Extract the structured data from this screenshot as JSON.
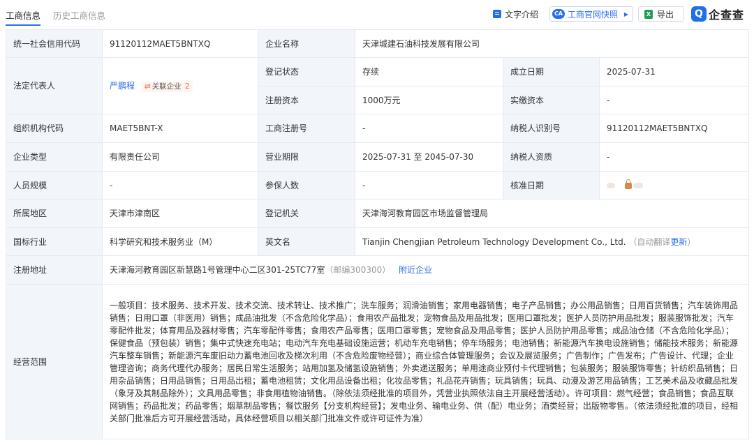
{
  "tabs": [
    {
      "label": "工商信息"
    },
    {
      "label": "历史工商信息"
    }
  ],
  "toolbar": {
    "intro_label": "文字介绍",
    "snapshot_badge": "CA",
    "snapshot_label": "工商官网快照",
    "export_label": "导出"
  },
  "logo": {
    "text": "企查查"
  },
  "labels": {
    "credit_code": "统一社会信用代码",
    "company_name": "企业名称",
    "legal_rep": "法定代表人",
    "reg_status": "登记状态",
    "est_date": "成立日期",
    "reg_capital": "注册资本",
    "paid_capital": "实缴资本",
    "org_code": "组织机构代码",
    "reg_number": "工商注册号",
    "taxpayer_id": "纳税人识别号",
    "company_type": "企业类型",
    "business_term": "营业期限",
    "taxpayer_qual": "纳税人资质",
    "staff_size": "人员规模",
    "insured": "参保人数",
    "approval_date": "核准日期",
    "region": "所属地区",
    "reg_authority": "登记机关",
    "industry": "国标行业",
    "english_name": "英文名",
    "reg_address": "注册地址",
    "business_scope": "经营范围"
  },
  "values": {
    "credit_code": "91120112MAET5BNTXQ",
    "company_name": "天津城建石油科技发展有限公司",
    "legal_rep": "严鹏程",
    "related_label": "关联企业",
    "related_count": "2",
    "reg_status": "存续",
    "est_date": "2025-07-31",
    "reg_capital": "1000万元",
    "paid_capital": "-",
    "org_code": "MAET5BNT-X",
    "reg_number": "-",
    "taxpayer_id": "91120112MAET5BNTXQ",
    "company_type": "有限责任公司",
    "business_term": "2025-07-31 至 2045-07-30",
    "taxpayer_qual": "-",
    "staff_size": "-",
    "insured": "-",
    "region": "天津市津南区",
    "reg_authority": "天津海河教育园区市场监督管理局",
    "industry": "科学研究和技术服务业（M）",
    "english_name": "Tianjin Chengjian Petroleum Technology Development Co., Ltd.",
    "english_note_prefix": "（自动翻译",
    "english_note_link": "更新",
    "english_note_suffix": "）",
    "reg_address": "天津海河教育园区新慧路1号管理中心二区301-25TC77室",
    "postcode": "（邮编300300）",
    "nearby": "附近企业",
    "business_scope": "一般项目：技术服务、技术开发、技术交流、技术转让、技术推广；洗车服务；润滑油销售；家用电器销售；电子产品销售；办公用品销售；日用百货销售；汽车装饰用品销售；日用口罩（非医用）销售；成品油批发（不含危险化学品）；食用农产品批发；宠物食品及用品批发；医用口罩批发；医护人员防护用品批发；服装服饰批发；汽车零配件批发；体育用品及器材零售；汽车零配件零售；食用农产品零售；医用口罩零售；宠物食品及用品零售；医护人员防护用品零售；成品油仓储（不含危险化学品）；保健食品（预包装）销售；集中式快速充电站；电动汽车充电基础设施运营；机动车充电销售；停车场服务；电池销售；新能源汽车换电设施销售；储能技术服务；新能源汽车整车销售；新能源汽车废旧动力蓄电池回收及梯次利用（不含危险废物经营）；商业综合体管理服务；会议及展览服务；广告制作；广告发布；广告设计、代理；企业管理咨询；商务代理代办服务；居民日常生活服务；站用加氢及储氢设施销售；外卖递送服务；单用途商业预付卡代理销售；包装服务；服装服饰零售；针纺织品销售；日用杂品销售；日用品销售；日用品出租；蓄电池租赁；文化用品设备出租；化妆品零售；礼品花卉销售；玩具销售；玩具、动漫及游艺用品销售；工艺美术品及收藏品批发（象牙及其制品除外）；文具用品零售；非食用植物油销售。（除依法须经批准的项目外，凭营业执照依法自主开展经营活动）。许可项目：燃气经营；食品销售；食品互联网销售；药品批发；药品零售；烟草制品零售；餐饮服务【分支机构经营】；发电业务、输电业务、供（配）电业务；酒类经营；出版物零售。（依法须经批准的项目，经相关部门批准后方可开展经营活动，具体经营项目以相关部门批准文件或许可证件为准）"
  }
}
